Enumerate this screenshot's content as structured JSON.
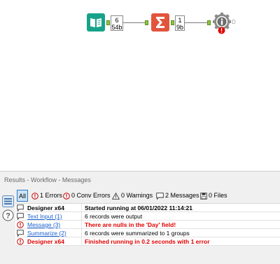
{
  "workflow": {
    "tools": [
      {
        "name": "Text Input",
        "badge_top": "6",
        "badge_bottom": "54b"
      },
      {
        "name": "Summarize",
        "badge_top": "1",
        "badge_bottom": "9b"
      },
      {
        "name": "Message",
        "anchor_label": "D"
      }
    ]
  },
  "results": {
    "title": "Results - Workflow - Messages",
    "filters": {
      "all": "All",
      "errors": "1 Errors",
      "conv_errors": "0 Conv Errors",
      "warnings": "0 Warnings",
      "messages": "2 Messages",
      "files": "0 Files"
    },
    "rows": [
      {
        "type": "message",
        "source": "Designer x64",
        "message": "Started running at 06/01/2022 11:14:21"
      },
      {
        "type": "message",
        "source": "Text Input (1)",
        "message": "6 records were output"
      },
      {
        "type": "error",
        "source": "Message (3)",
        "message": "There are nulls in the 'Day' field!"
      },
      {
        "type": "message",
        "source": "Summarize (2)",
        "message": "6 records were summarized to 1 groups"
      },
      {
        "type": "error",
        "source": "Designer x64",
        "message": "Finished running in 0.2 seconds with 1 error"
      }
    ]
  },
  "colors": {
    "text_input_tool": "#17a38a",
    "summarize_tool": "#e2553c",
    "message_tool": "#7f7f7f",
    "error": "#e00000",
    "link": "#1a5fd1",
    "anchor": "#8cc63f"
  }
}
